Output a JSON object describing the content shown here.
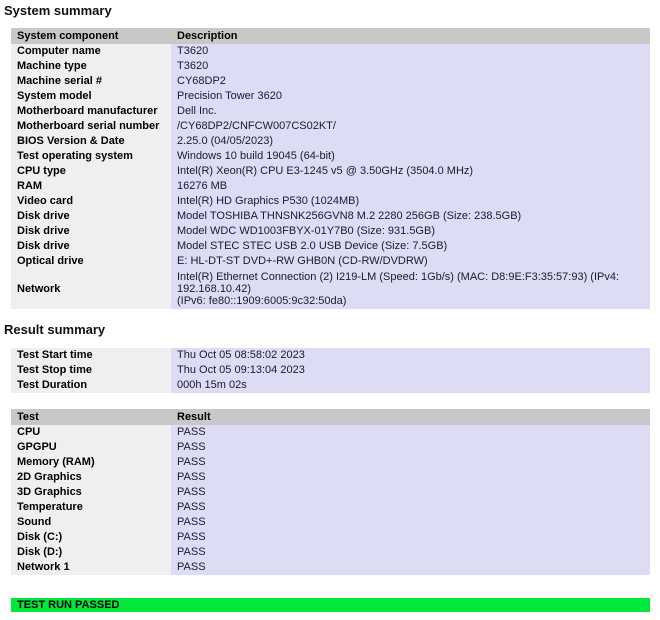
{
  "headings": {
    "system_summary": "System summary",
    "result_summary": "Result summary"
  },
  "system_table": {
    "headers": {
      "component": "System component",
      "description": "Description"
    },
    "rows": [
      {
        "component": "Computer name",
        "description": "T3620"
      },
      {
        "component": "Machine type",
        "description": "T3620"
      },
      {
        "component": "Machine serial #",
        "description": "CY68DP2"
      },
      {
        "component": "System model",
        "description": "Precision Tower 3620"
      },
      {
        "component": "Motherboard manufacturer",
        "description": "Dell Inc."
      },
      {
        "component": "Motherboard serial number",
        "description": "/CY68DP2/CNFCW007CS02KT/"
      },
      {
        "component": "BIOS Version & Date",
        "description": "2.25.0 (04/05/2023)"
      },
      {
        "component": "Test operating system",
        "description": "Windows 10 build 19045 (64-bit)"
      },
      {
        "component": "CPU type",
        "description": "Intel(R) Xeon(R) CPU E3-1245 v5 @ 3.50GHz (3504.0 MHz)"
      },
      {
        "component": "RAM",
        "description": "16276 MB"
      },
      {
        "component": "Video card",
        "description": "Intel(R) HD Graphics P530 (1024MB)"
      },
      {
        "component": "Disk drive",
        "description": "Model TOSHIBA THNSNK256GVN8 M.2 2280 256GB (Size: 238.5GB)"
      },
      {
        "component": "Disk drive",
        "description": "Model WDC WD1003FBYX-01Y7B0 (Size: 931.5GB)"
      },
      {
        "component": "Disk drive",
        "description": "Model STEC STEC USB 2.0 USB Device (Size: 7.5GB)"
      },
      {
        "component": "Optical drive",
        "description": "E: HL-DT-ST DVD+-RW GHB0N (CD-RW/DVDRW)"
      }
    ],
    "network_row": {
      "component": "Network",
      "line1": "Intel(R) Ethernet Connection (2) I219-LM (Speed: 1Gb/s) (MAC: D8:9E:F3:35:57:93) (IPv4: 192.168.10.42)",
      "line2": "(IPv6: fe80::1909:6005:9c32:50da)"
    }
  },
  "timing_table": {
    "rows": [
      {
        "label": "Test Start time",
        "value": "Thu Oct 05 08:58:02 2023"
      },
      {
        "label": "Test Stop time",
        "value": "Thu Oct 05 09:13:04 2023"
      },
      {
        "label": "Test Duration",
        "value": "000h 15m 02s"
      }
    ]
  },
  "tests_table": {
    "headers": {
      "test": "Test",
      "result": "Result"
    },
    "rows": [
      {
        "test": "CPU",
        "result": "PASS"
      },
      {
        "test": "GPGPU",
        "result": "PASS"
      },
      {
        "test": "Memory (RAM)",
        "result": "PASS"
      },
      {
        "test": "2D Graphics",
        "result": "PASS"
      },
      {
        "test": "3D Graphics",
        "result": "PASS"
      },
      {
        "test": "Temperature",
        "result": "PASS"
      },
      {
        "test": "Sound",
        "result": "PASS"
      },
      {
        "test": "Disk (C:)",
        "result": "PASS"
      },
      {
        "test": "Disk (D:)",
        "result": "PASS"
      },
      {
        "test": "Network 1",
        "result": "PASS"
      }
    ]
  },
  "banner": {
    "text": "TEST RUN PASSED",
    "color": "#00e83c"
  },
  "colors": {
    "header_row": "#c8c8c8",
    "key_cell": "#efefef",
    "value_cell": "#dcdcf4",
    "pass_banner": "#00e83c",
    "page_background": "#ffffff"
  }
}
